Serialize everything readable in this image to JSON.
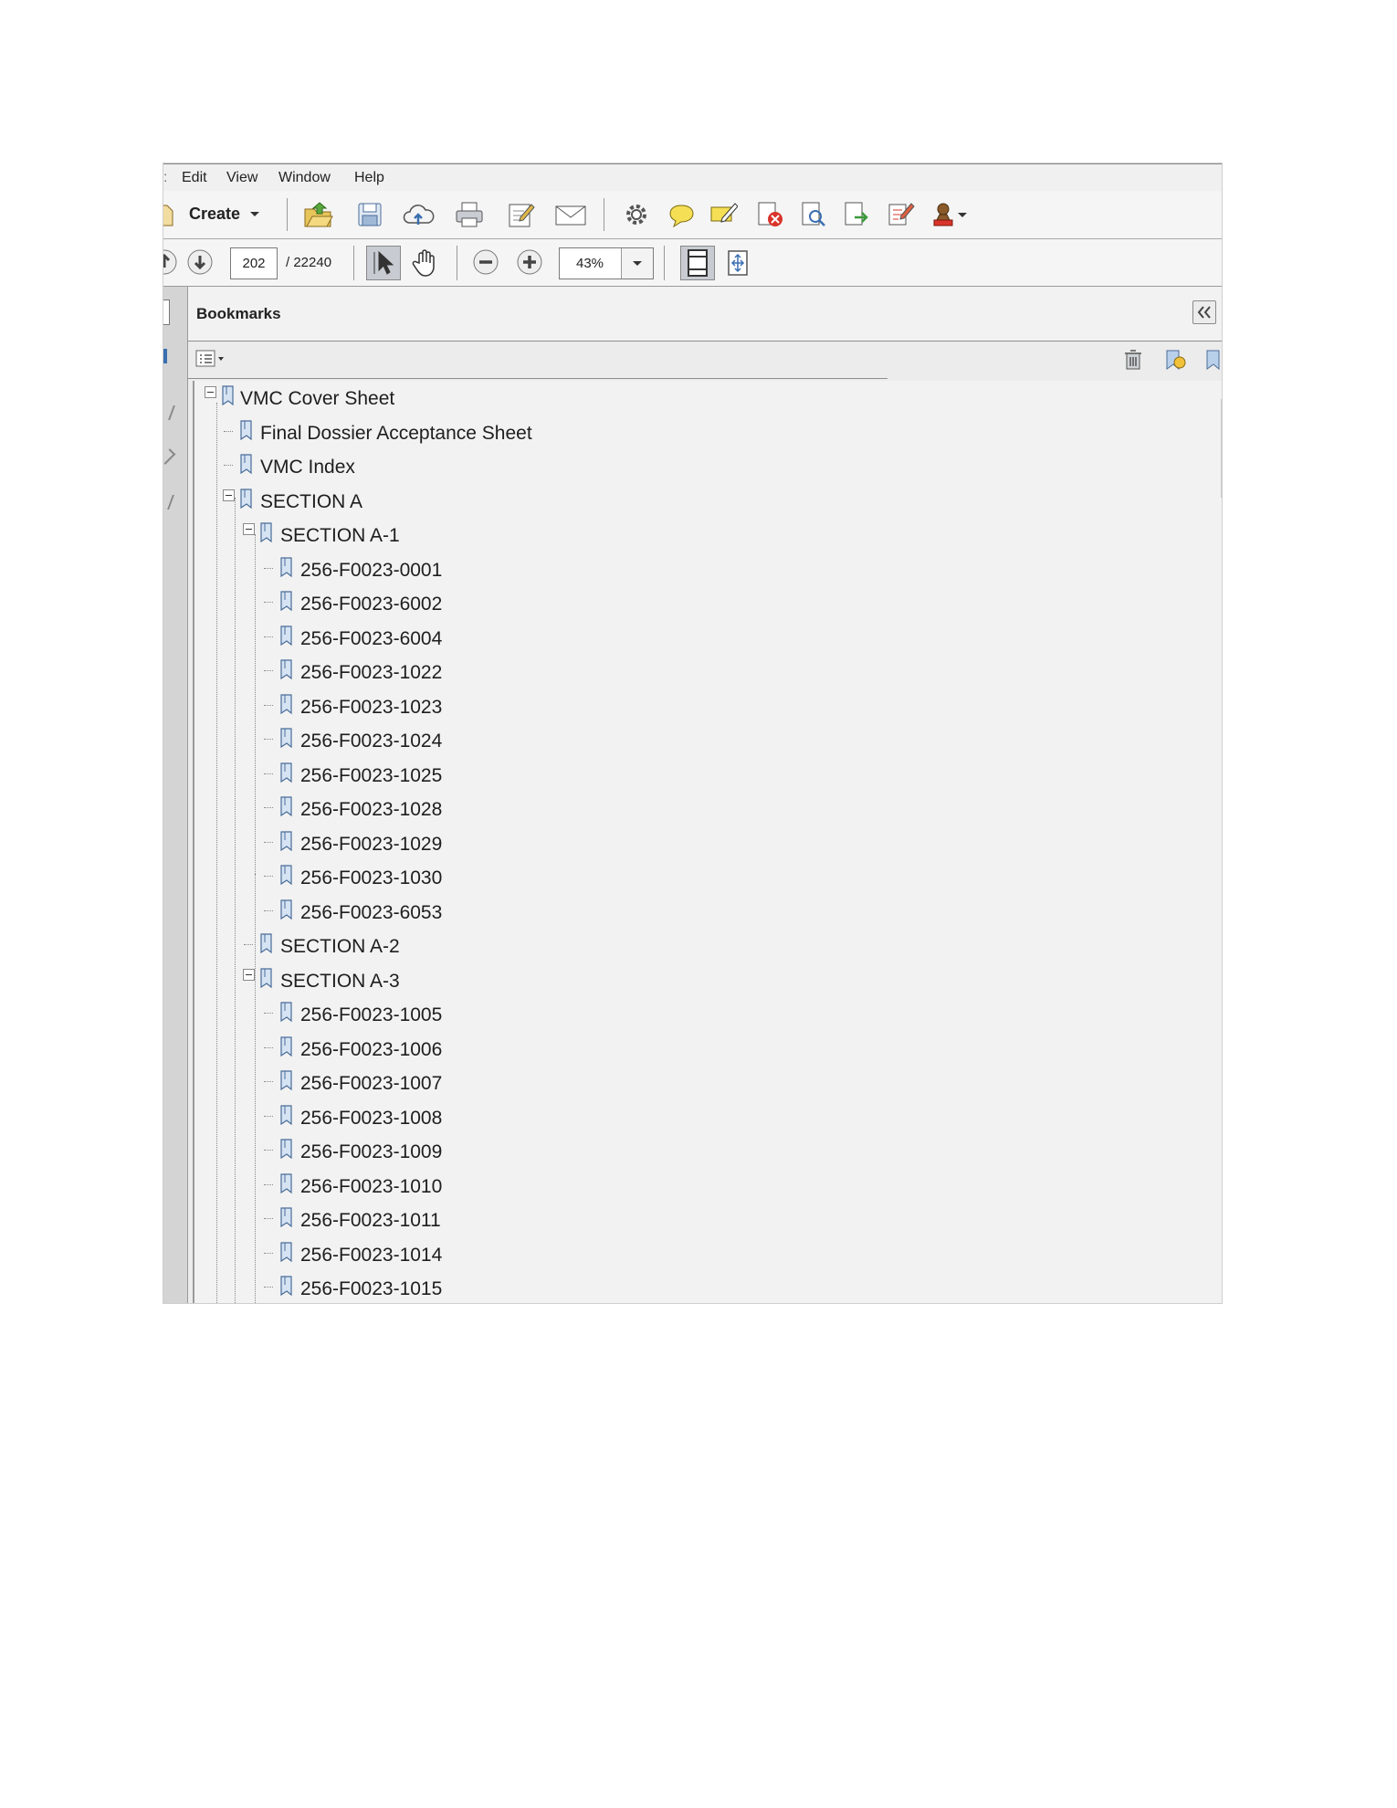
{
  "menu": [
    "Edit",
    "View",
    "Window",
    "Help"
  ],
  "toolbar": {
    "create_label": "Create",
    "page_current": "202",
    "page_total": "/ 22240",
    "zoom": "43%"
  },
  "bookmarks": {
    "title": "Bookmarks",
    "items": [
      {
        "label": "VMC Cover Sheet",
        "level": 0,
        "expanded": true
      },
      {
        "label": "Final Dossier Acceptance Sheet",
        "level": 1
      },
      {
        "label": "VMC Index",
        "level": 1
      },
      {
        "label": "SECTION A",
        "level": 1,
        "expanded": true
      },
      {
        "label": "SECTION A-1",
        "level": 2,
        "expanded": true
      },
      {
        "label": "256-F0023-0001",
        "level": 3
      },
      {
        "label": "256-F0023-6002",
        "level": 3
      },
      {
        "label": "256-F0023-6004",
        "level": 3
      },
      {
        "label": "256-F0023-1022",
        "level": 3
      },
      {
        "label": "256-F0023-1023",
        "level": 3
      },
      {
        "label": "256-F0023-1024",
        "level": 3
      },
      {
        "label": "256-F0023-1025",
        "level": 3
      },
      {
        "label": "256-F0023-1028",
        "level": 3
      },
      {
        "label": "256-F0023-1029",
        "level": 3
      },
      {
        "label": "256-F0023-1030",
        "level": 3
      },
      {
        "label": "256-F0023-6053",
        "level": 3
      },
      {
        "label": "SECTION A-2",
        "level": 2
      },
      {
        "label": "SECTION A-3",
        "level": 2,
        "expanded": true
      },
      {
        "label": "256-F0023-1005",
        "level": 3
      },
      {
        "label": "256-F0023-1006",
        "level": 3
      },
      {
        "label": "256-F0023-1007",
        "level": 3
      },
      {
        "label": "256-F0023-1008",
        "level": 3
      },
      {
        "label": "256-F0023-1009",
        "level": 3
      },
      {
        "label": "256-F0023-1010",
        "level": 3
      },
      {
        "label": "256-F0023-1011",
        "level": 3
      },
      {
        "label": "256-F0023-1014",
        "level": 3
      },
      {
        "label": "256-F0023-1015",
        "level": 3
      }
    ]
  }
}
